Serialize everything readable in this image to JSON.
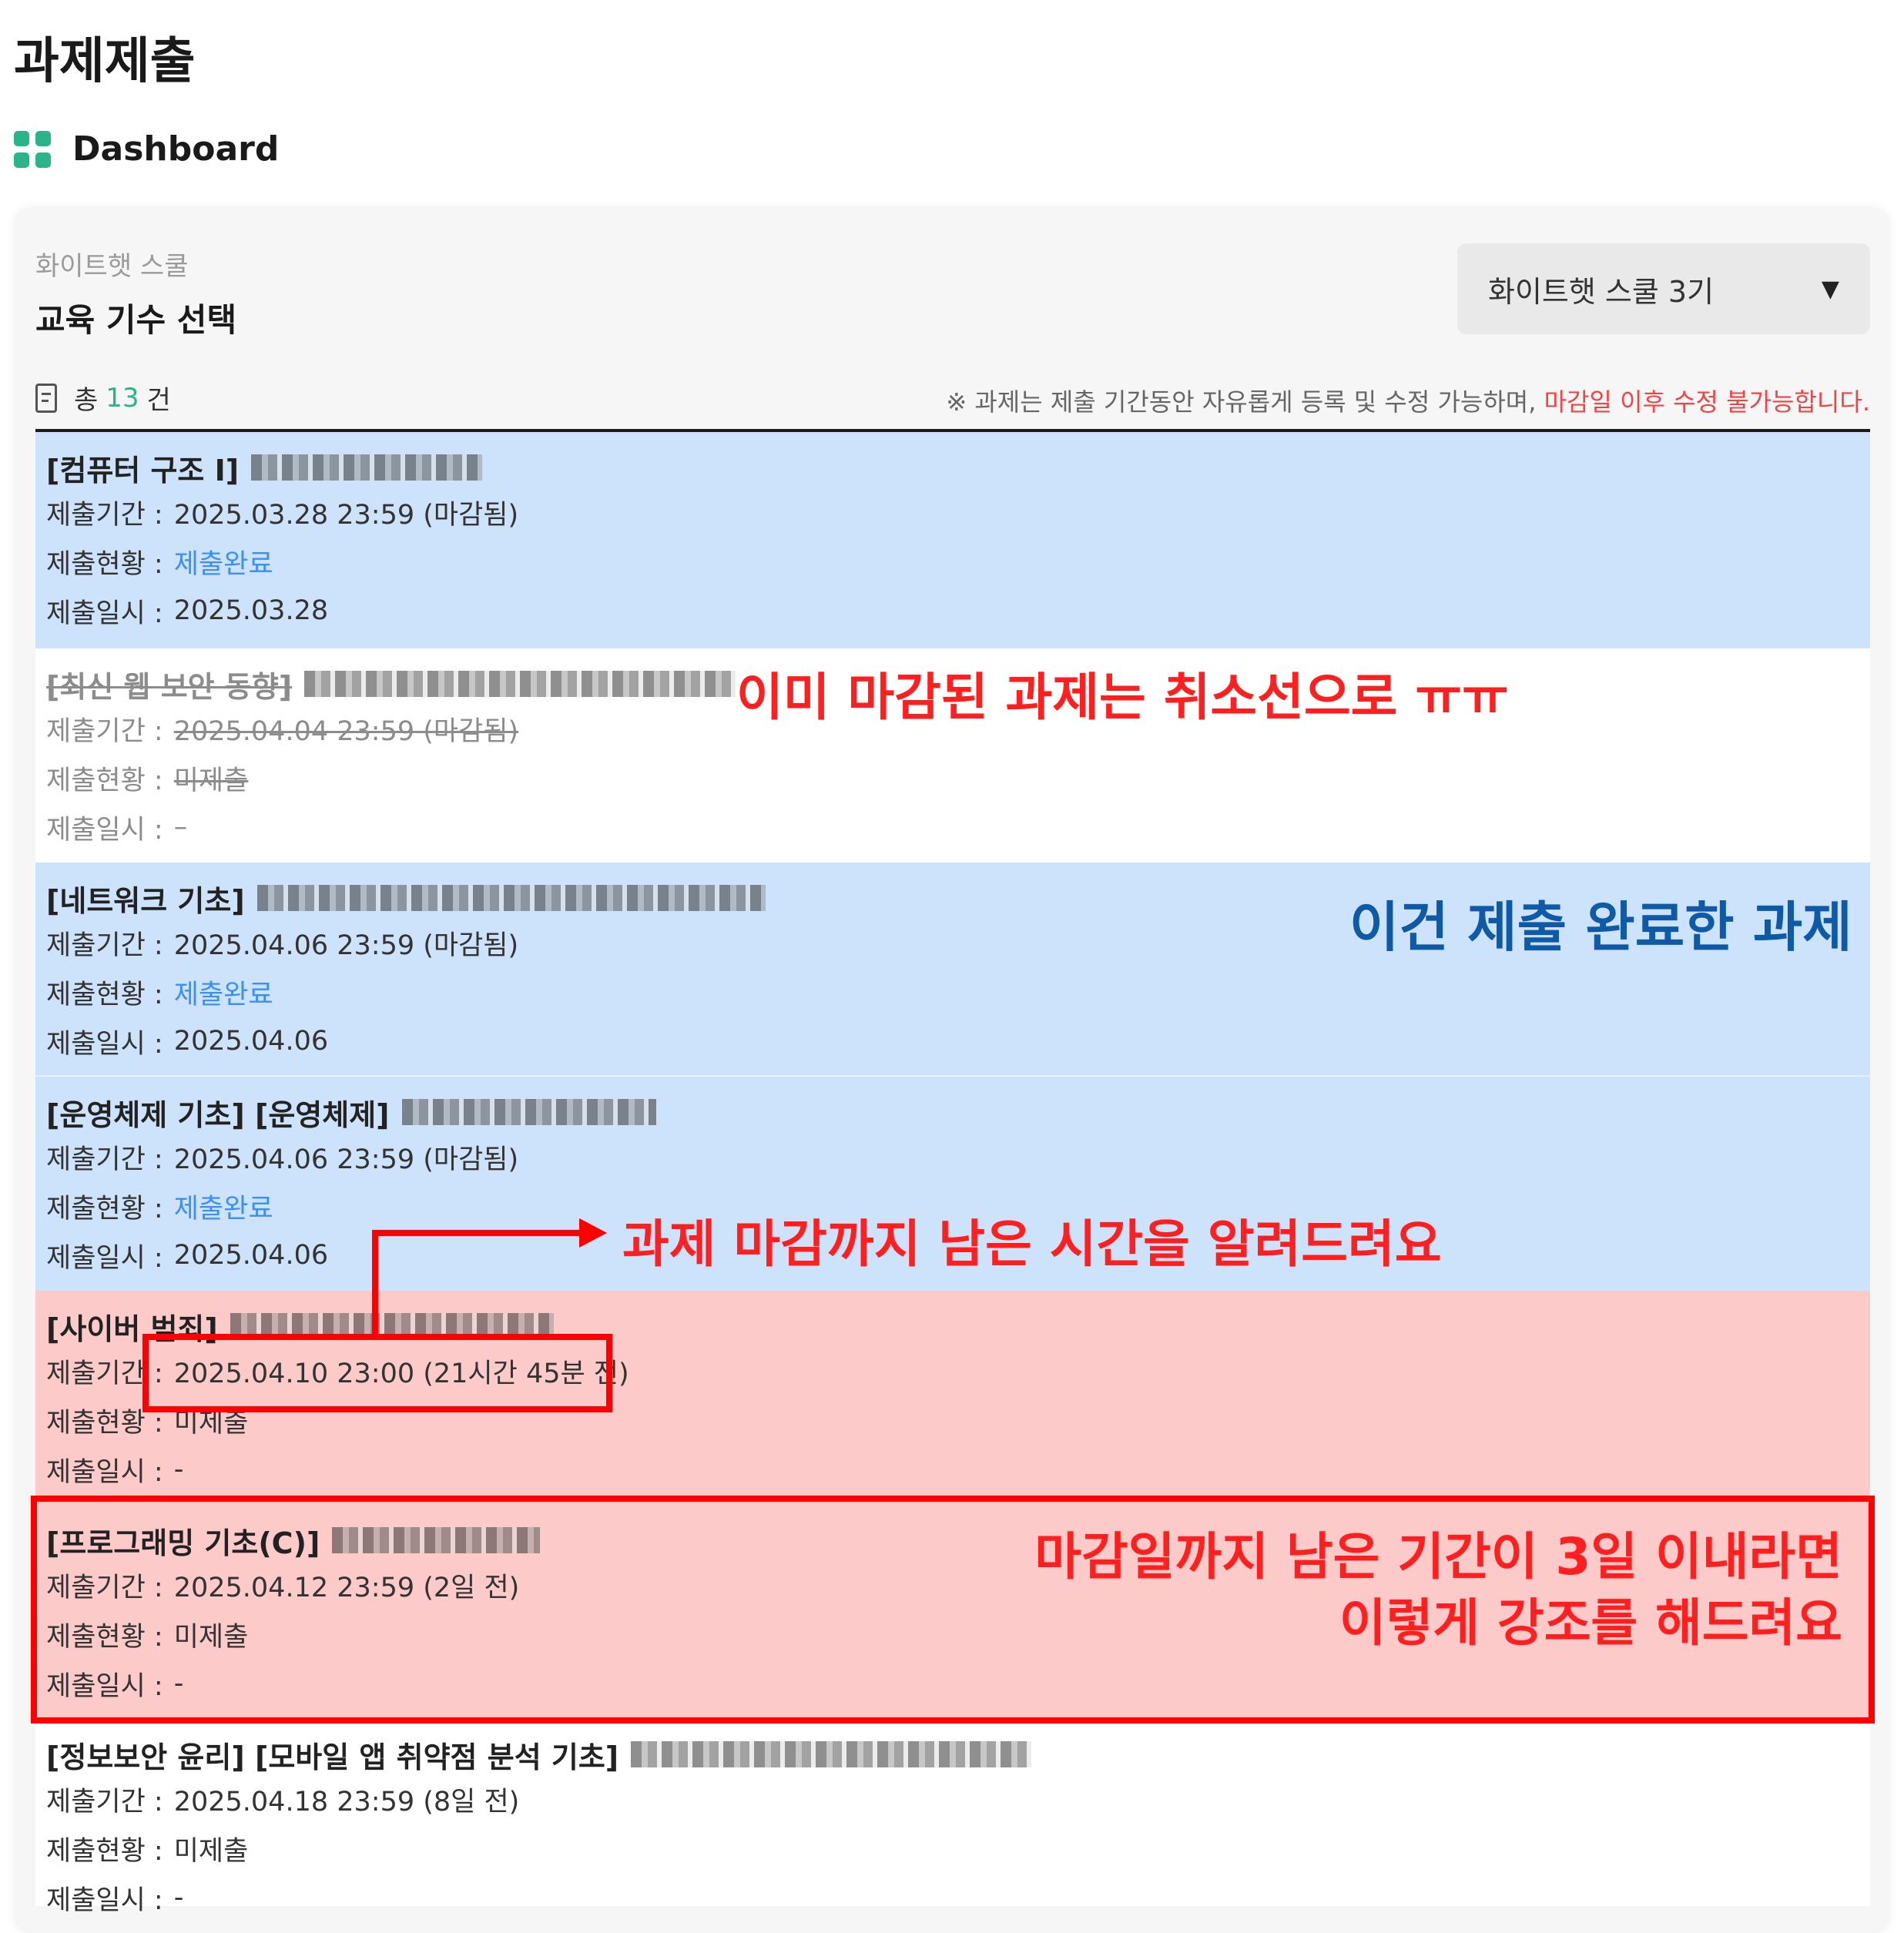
{
  "header": {
    "title": "과제제출",
    "nav_label": "Dashboard"
  },
  "panel": {
    "org": "화이트햇 스쿨",
    "cohort_label": "교육 기수 선택",
    "cohort_select": "화이트햇 스쿨 3기",
    "count_prefix": "총",
    "count": "13",
    "count_suffix": "건",
    "notice_prefix": "※ 과제는 제출 기간동안 자유롭게 등록 및 수정 가능하며,",
    "notice_warn": "마감일 이후 수정 불가능합니다."
  },
  "labels": {
    "period": "제출기간 :",
    "status": "제출현황 :",
    "date": "제출일시 :"
  },
  "assignments": [
    {
      "title": "[컴퓨터 구조 I]",
      "period": "2025.03.28 23:59 (마감됨)",
      "status": "제출완료",
      "date": "2025.03.28",
      "state": "done"
    },
    {
      "title": "[최신 웹 보안 동향]",
      "period": "2025.04.04 23:59 (마감됨)",
      "status": "미제출",
      "date": "–",
      "state": "closed"
    },
    {
      "title": "[네트워크 기초]",
      "period": "2025.04.06 23:59 (마감됨)",
      "status": "제출완료",
      "date": "2025.04.06",
      "state": "done"
    },
    {
      "title": "[운영체제 기초] [운영체제]",
      "period": "2025.04.06 23:59 (마감됨)",
      "status": "제출완료",
      "date": "2025.04.06",
      "state": "done"
    },
    {
      "title": "[사이버 범죄]",
      "period": "2025.04.10 23:00 (21시간 45분 전)",
      "status": "미제출",
      "date": "-",
      "state": "urgent"
    },
    {
      "title": "[프로그래밍 기초(C)]",
      "period": "2025.04.12 23:59 (2일 전)",
      "status": "미제출",
      "date": "-",
      "state": "urgent"
    },
    {
      "title": "[정보보안 윤리] [모바일 앱 취약점 분석 기초]",
      "period": "2025.04.18 23:59 (8일 전)",
      "status": "미제출",
      "date": "-",
      "state": "normal"
    }
  ],
  "annotations": {
    "closed_note": "이미 마감된 과제는 취소선으로 ㅠㅠ",
    "done_note": "이건 제출 완료한 과제",
    "time_note": "과제 마감까지 남은 시간을 알려드려요",
    "urgent_note_line1": "마감일까지 남은 기간이 3일 이내라면",
    "urgent_note_line2": "이렇게 강조를 해드려요"
  },
  "colors": {
    "accent": "#2bb389",
    "done_bg": "#cce3fb",
    "urgent_bg": "#fdcaca",
    "annotation_red": "#ff1f1f",
    "annotation_blue": "#0e5aa6",
    "status_link": "#3c8ff5"
  }
}
